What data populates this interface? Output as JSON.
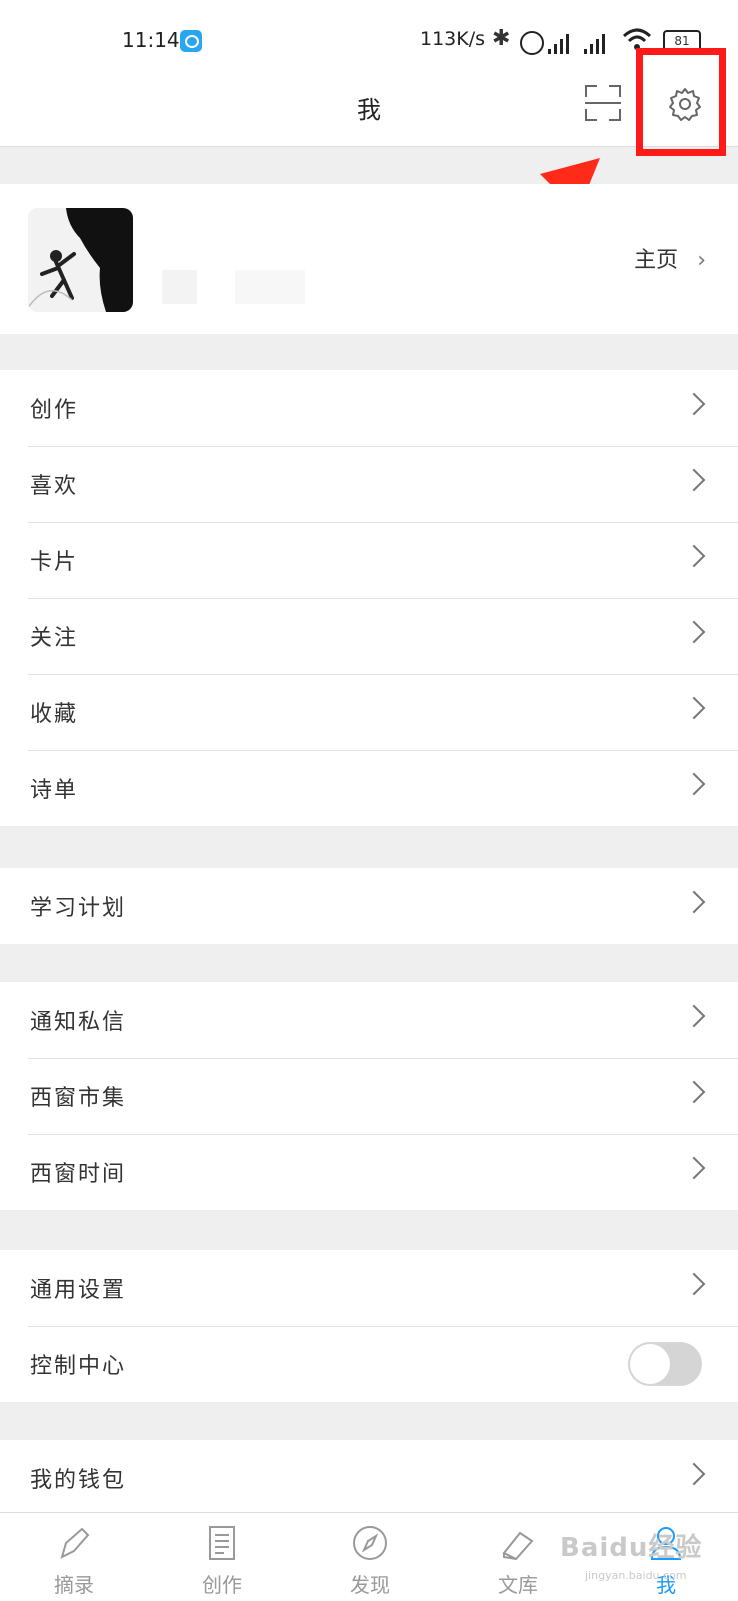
{
  "status_bar": {
    "time": "11:14",
    "speed": "113K/s",
    "battery": "81"
  },
  "header": {
    "title": "我",
    "scan_icon": "scan-icon",
    "settings_icon": "gear-icon"
  },
  "profile": {
    "homepage_label": "主页"
  },
  "groups": {
    "g1": [
      "创作",
      "喜欢",
      "卡片",
      "关注",
      "收藏",
      "诗单"
    ],
    "g2": [
      "学习计划"
    ],
    "g3": [
      "通知私信",
      "西窗市集",
      "西窗时间"
    ],
    "g4": [
      "通用设置",
      "控制中心"
    ],
    "g5": [
      "我的钱包"
    ]
  },
  "tabs": [
    {
      "label": "摘录",
      "icon": "pen-icon"
    },
    {
      "label": "创作",
      "icon": "document-icon"
    },
    {
      "label": "发现",
      "icon": "compass-icon"
    },
    {
      "label": "文库",
      "icon": "books-icon"
    },
    {
      "label": "我",
      "icon": "person-icon"
    }
  ],
  "watermark": "Baidu经验",
  "watermark_sub": "jingyan.baidu.com",
  "colors": {
    "accent": "#1a9cff",
    "highlight": "#ff1a1a"
  }
}
